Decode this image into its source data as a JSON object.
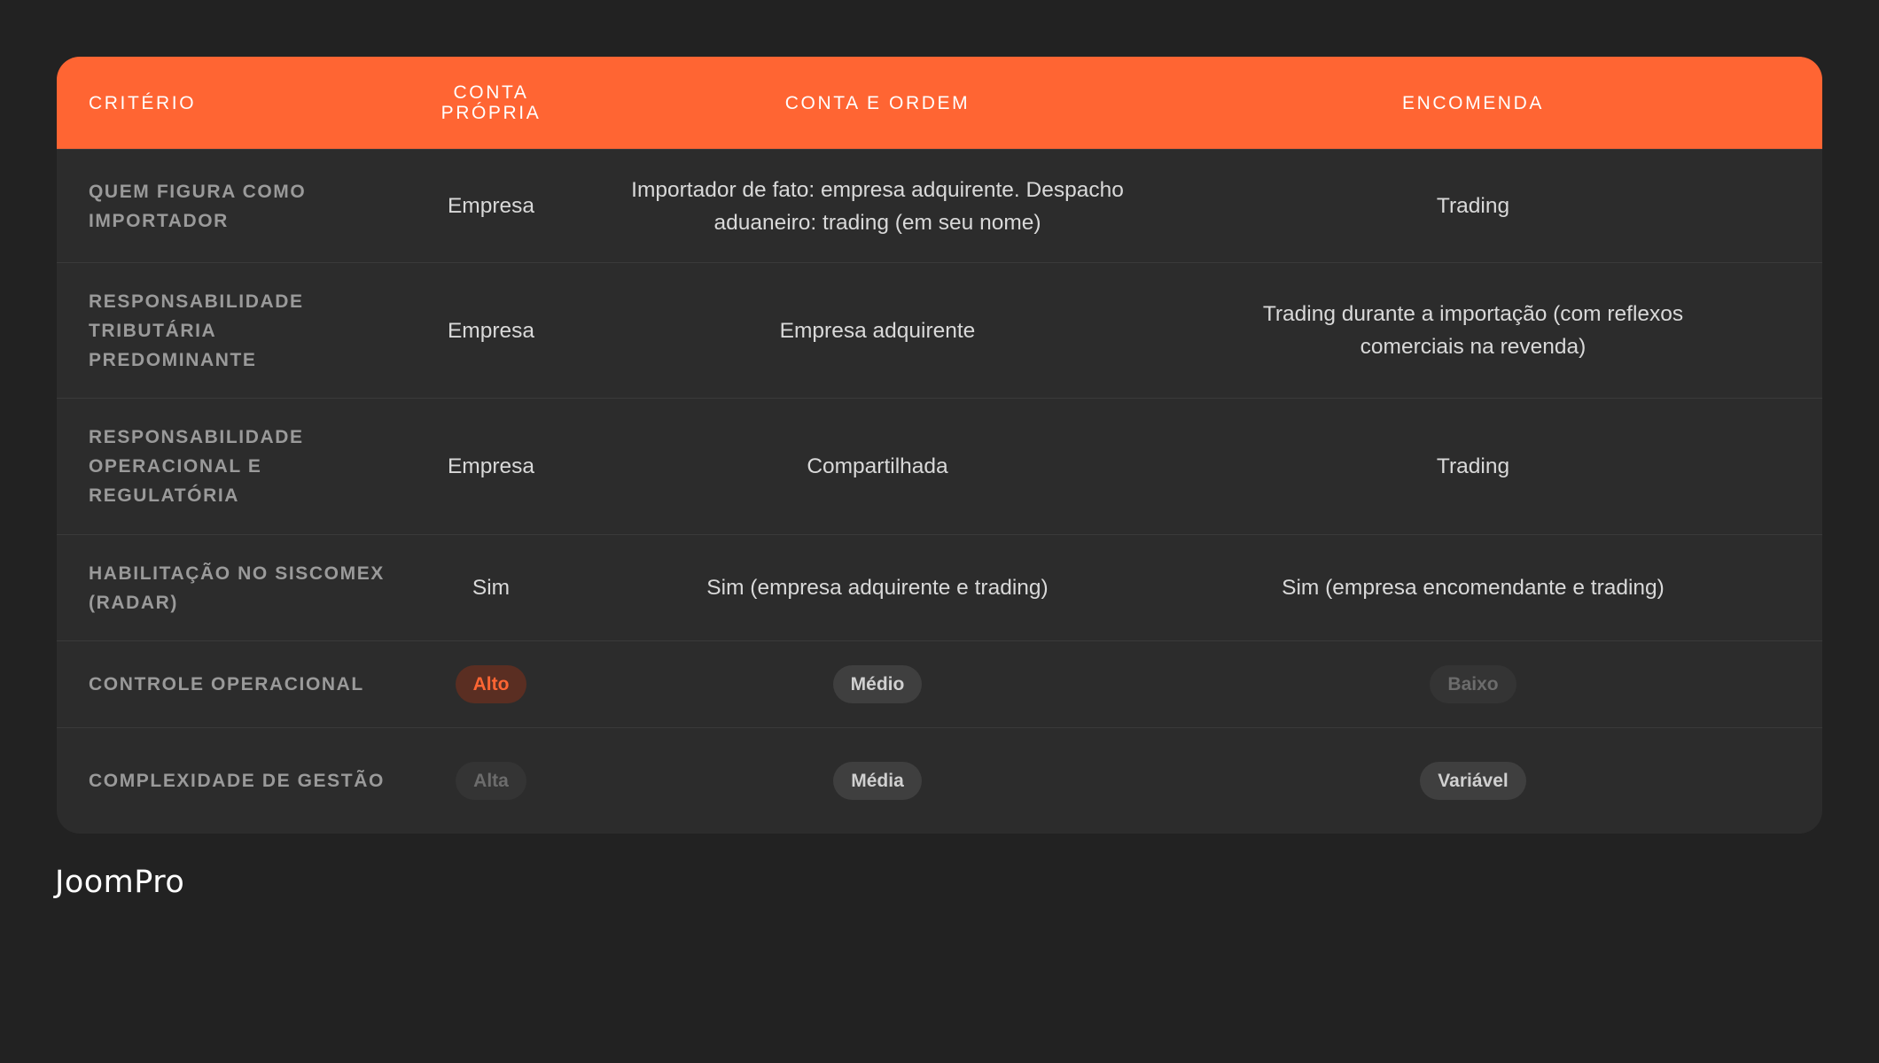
{
  "header": {
    "col1": "CRITÉRIO",
    "col2": "CONTA PRÓPRIA",
    "col3": "CONTA E ORDEM",
    "col4": "ENCOMENDA"
  },
  "rows": [
    {
      "criterion": "QUEM FIGURA COMO IMPORTADOR",
      "conta_propria": "Empresa",
      "conta_e_ordem": "Importador de fato: empresa adquirente. Despacho aduaneiro: trading (em seu nome)",
      "encomenda": "Trading"
    },
    {
      "criterion": "RESPONSABILIDADE TRIBUTÁRIA PREDOMINANTE",
      "conta_propria": "Empresa",
      "conta_e_ordem": "Empresa adquirente",
      "encomenda": "Trading durante a importação (com reflexos comerciais na revenda)"
    },
    {
      "criterion": "RESPONSABILIDADE OPERACIONAL E REGULATÓRIA",
      "conta_propria": "Empresa",
      "conta_e_ordem": "Compartilhada",
      "encomenda": "Trading"
    },
    {
      "criterion": "HABILITAÇÃO NO SISCOMEX (RADAR)",
      "conta_propria": "Sim",
      "conta_e_ordem": "Sim (empresa adquirente e trading)",
      "encomenda": "Sim (empresa encomendante e trading)"
    },
    {
      "criterion": "CONTROLE OPERACIONAL",
      "conta_propria": "Alto",
      "conta_e_ordem": "Médio",
      "encomenda": "Baixo"
    },
    {
      "criterion": "COMPLEXIDADE DE GESTÃO",
      "conta_propria": "Alta",
      "conta_e_ordem": "Média",
      "encomenda": "Variável"
    }
  ],
  "brand": {
    "logo_text": "JoomPro"
  },
  "colors": {
    "accent": "#ff6533",
    "background": "#222222",
    "table": "#2c2c2c"
  }
}
